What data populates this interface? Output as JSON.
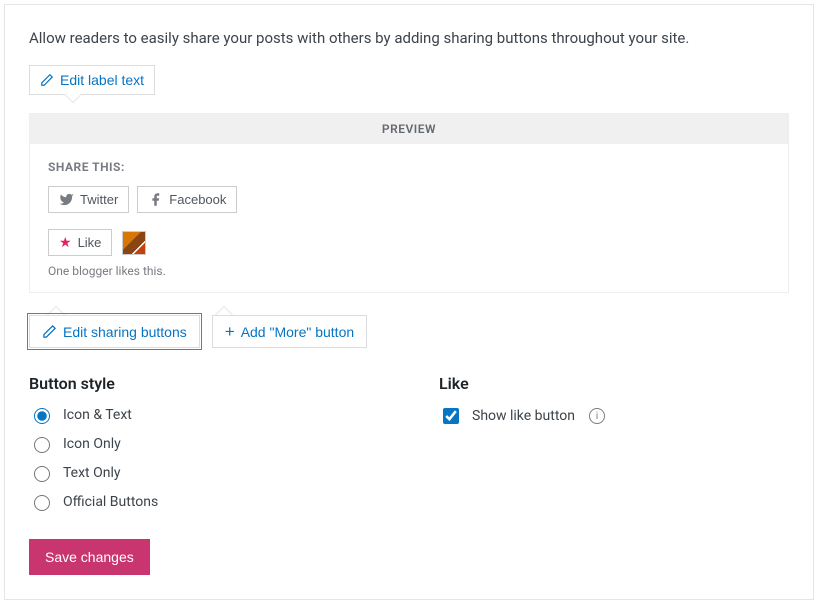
{
  "intro": "Allow readers to easily share your posts with others by adding sharing buttons throughout your site.",
  "edit_label": "Edit label text",
  "preview": {
    "header": "PREVIEW",
    "share_label": "SHARE THIS:",
    "twitter": "Twitter",
    "facebook": "Facebook",
    "like": "Like",
    "likers": "One blogger likes this."
  },
  "edit_sharing": "Edit sharing buttons",
  "add_more": "Add \"More\" button",
  "button_style": {
    "title": "Button style",
    "options": [
      "Icon & Text",
      "Icon Only",
      "Text Only",
      "Official Buttons"
    ],
    "selected": 0
  },
  "like_section": {
    "title": "Like",
    "show_like": "Show like button"
  },
  "save": "Save changes"
}
